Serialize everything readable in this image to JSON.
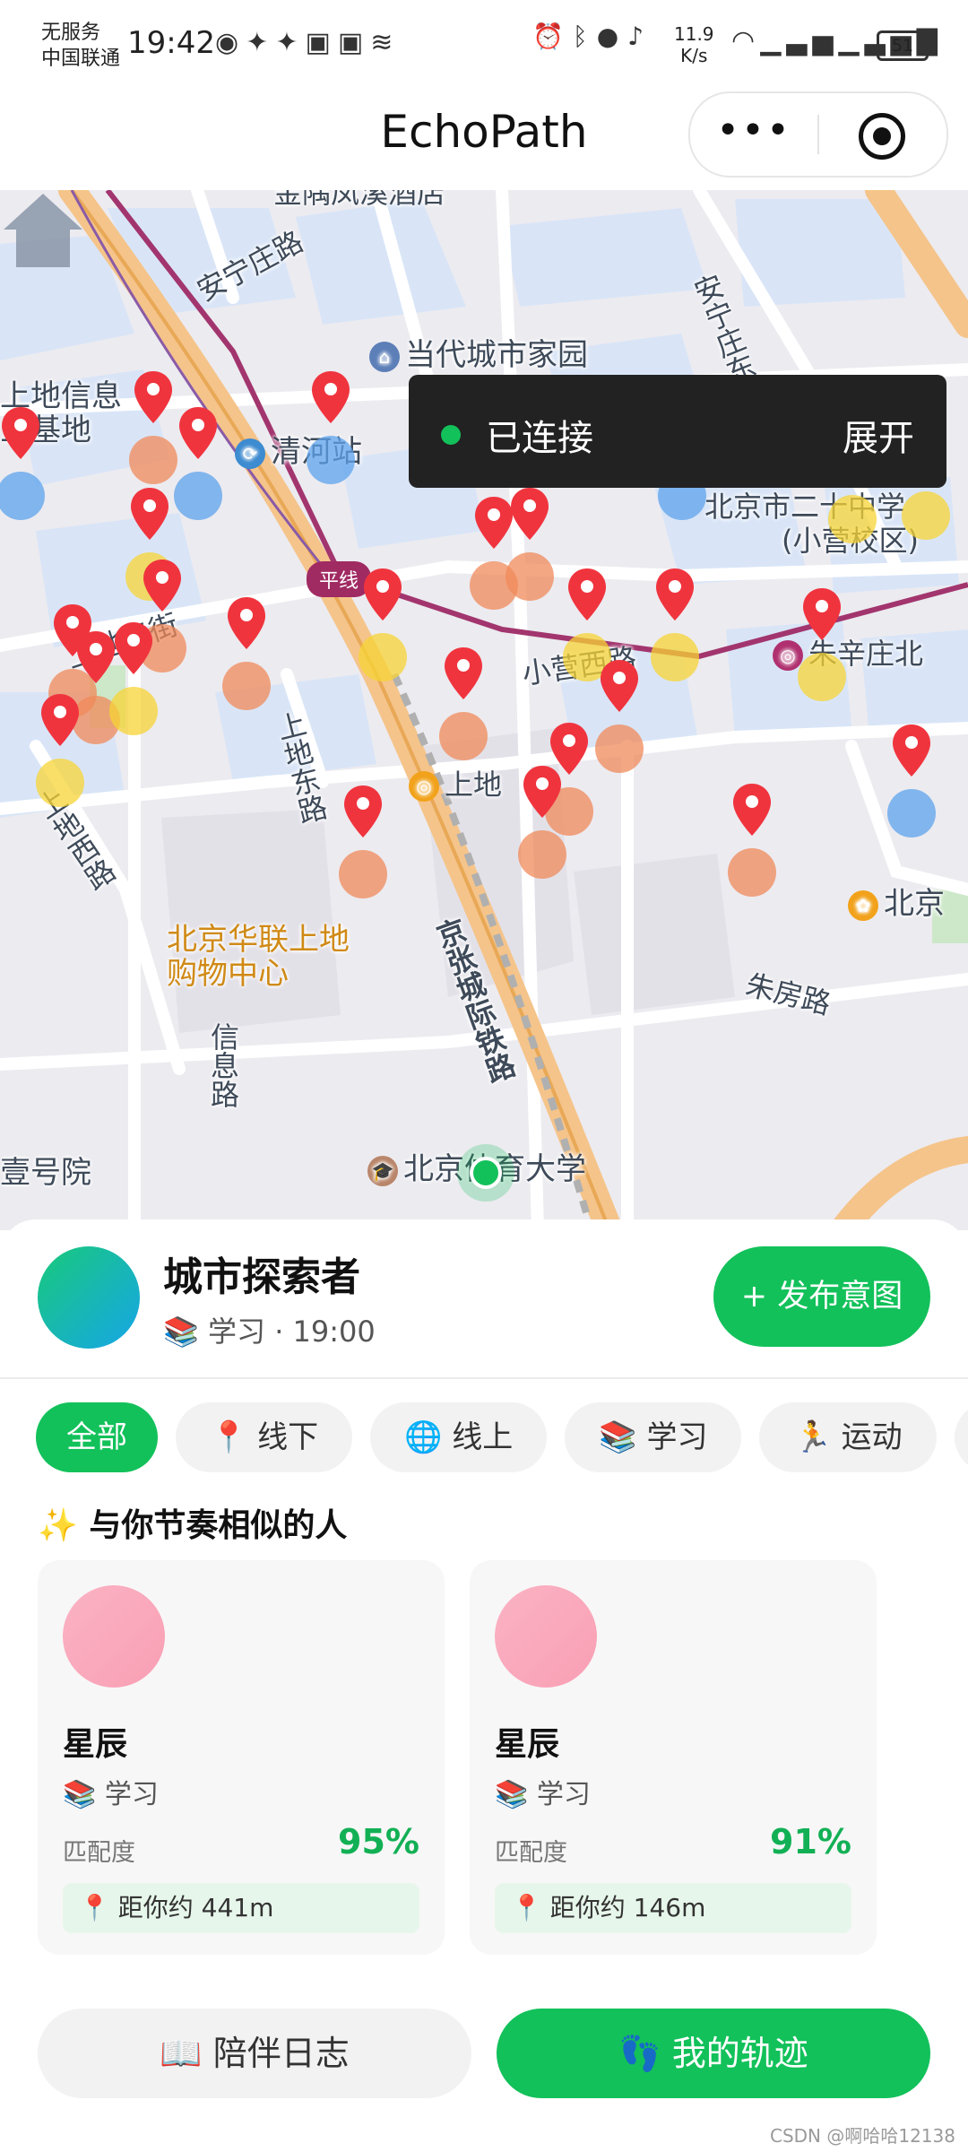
{
  "status_bar": {
    "carrier_line1": "无服务",
    "carrier_line2": "中国联通",
    "time": "19:42",
    "net_speed_value": "11.9",
    "net_speed_unit": "K/s",
    "battery": "51",
    "icons_left": [
      "eye-icon",
      "app-icon",
      "app-icon",
      "app-icon",
      "app-icon",
      "voice-icon"
    ],
    "icons_right": [
      "alarm-icon",
      "bluetooth-icon",
      "location-icon",
      "mute-icon",
      "hotspot-icon",
      "signal-icon",
      "5g-signal-icon"
    ]
  },
  "navbar": {
    "title": "EchoPath",
    "more_label": "•••"
  },
  "map": {
    "connection": {
      "status": "已连接",
      "action": "展开"
    },
    "metro_line_badge": "平线",
    "labels": [
      {
        "id": "top-poi",
        "text": "金隅凤溪酒店"
      },
      {
        "id": "anning",
        "text": "安宁庄路"
      },
      {
        "id": "dangdai",
        "text": "当代城市家园"
      },
      {
        "id": "shangdi-info",
        "text": "上地信息"
      },
      {
        "id": "shangdi-base",
        "text": "业基地"
      },
      {
        "id": "qinghe",
        "text": "清河站"
      },
      {
        "id": "anningdong",
        "text": "安宁庄东路"
      },
      {
        "id": "xiaoying-xi",
        "text": "小营西路"
      },
      {
        "id": "school",
        "text": "北京市二十中学"
      },
      {
        "id": "school-campus",
        "text": "(小营校区)"
      },
      {
        "id": "shangdi3",
        "text": "上地三街"
      },
      {
        "id": "zhuxinzhuang",
        "text": "朱辛庄北"
      },
      {
        "id": "shangdidong",
        "text": "上地东路"
      },
      {
        "id": "shangdi-stop",
        "text": "上地"
      },
      {
        "id": "shangdixi",
        "text": "上地西路"
      },
      {
        "id": "lianhua",
        "text": "北京华联上地"
      },
      {
        "id": "lianhua2",
        "text": "购物中心"
      },
      {
        "id": "beijing-right",
        "text": "北京"
      },
      {
        "id": "jingzhang",
        "text": "京张城际铁路"
      },
      {
        "id": "zhufang",
        "text": "朱房路"
      },
      {
        "id": "xinxi",
        "text": "信息路"
      },
      {
        "id": "yihao",
        "text": "壹号院"
      },
      {
        "id": "bsu",
        "text": "北京体育大学"
      }
    ]
  },
  "profile": {
    "name": "城市探索者",
    "meta": "📚 学习 · 19:00",
    "publish_button": "+ 发布意图"
  },
  "tabs": [
    {
      "id": "all",
      "label": "全部",
      "active": true
    },
    {
      "id": "offline",
      "label": "📍 线下",
      "active": false
    },
    {
      "id": "online",
      "label": "🌐 线上",
      "active": false
    },
    {
      "id": "study",
      "label": "📚 学习",
      "active": false
    },
    {
      "id": "sport",
      "label": "🏃 运动",
      "active": false
    }
  ],
  "section_title": "✨ 与你节奏相似的人",
  "cards": [
    {
      "name": "星辰",
      "category": "📚 学习",
      "match_label": "匹配度",
      "match": "95%",
      "distance": "📍 距你约 441m"
    },
    {
      "name": "星辰",
      "category": "📚 学习",
      "match_label": "匹配度",
      "match": "91%",
      "distance": "📍 距你约 146m"
    }
  ],
  "bottom_buttons": {
    "log": "📖 陪伴日志",
    "track": "👣 我的轨迹"
  },
  "watermark": "CSDN @啊哈哈12138",
  "colors": {
    "accent_green": "#12c15a",
    "pin_red": "#f0343e",
    "halo_blue": "#5ea3ec",
    "halo_yellow": "#f7d436",
    "halo_orange": "#f08a5a",
    "connection_bg": "#222222"
  }
}
